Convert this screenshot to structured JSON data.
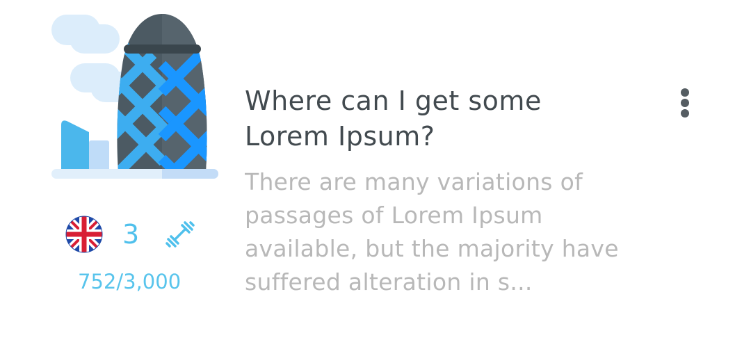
{
  "card": {
    "title": "Where can I get some Lorem Ipsum?",
    "description": "There are many variations of passages of Lorem Ipsum available, but the majority have suffered alteration in s...",
    "level": "3",
    "progress_text": "752/3,000",
    "language_flag_icon": "uk-flag-icon",
    "difficulty_icon": "dumbbell-icon",
    "menu_icon": "vertical-dots-icon",
    "illustration_icon": "gherkin-building-icon"
  },
  "colors": {
    "accent": "#4fc0ec",
    "title": "#424a4f",
    "body": "#b8b8b8",
    "building_blue": "#1a96ff",
    "building_dark": "#4c5a63"
  }
}
